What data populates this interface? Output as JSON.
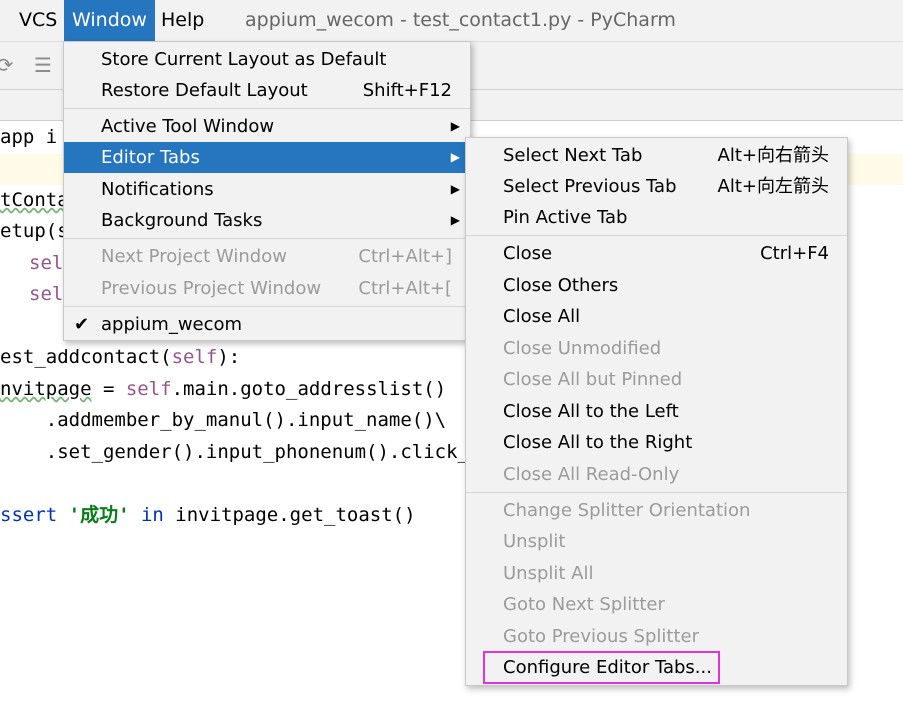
{
  "menubar": {
    "vcs": "VCS",
    "window": "Window",
    "help": "Help",
    "title": "appium_wecom - test_contact1.py - PyCharm"
  },
  "code": {
    "l1": "app i",
    "l2": "tConta",
    "l3": "etup(s",
    "l4": "sel",
    "l5": "sel",
    "l6a": "est_addcontact(",
    "l6b": "self",
    "l6c": "):",
    "l7a": "nvitpage",
    "l7b": " = ",
    "l7c": "self",
    "l7d": ".main.goto_addresslist()",
    "l8": "    .addmember_by_manul().input_name()\\",
    "l9": "    .set_gender().input_phonenum().click_",
    "l10a": "ssert ",
    "l10b": "'成功'",
    "l10c": " in ",
    "l10d": "invitpage.get_toast()"
  },
  "window_menu": {
    "store_layout": "Store Current Layout as Default",
    "restore_layout": "Restore Default Layout",
    "restore_shortcut": "Shift+F12",
    "active_tool": "Active Tool Window",
    "editor_tabs": "Editor Tabs",
    "notifications": "Notifications",
    "background_tasks": "Background Tasks",
    "next_project": "Next Project Window",
    "next_project_shortcut": "Ctrl+Alt+]",
    "prev_project": "Previous Project Window",
    "prev_project_shortcut": "Ctrl+Alt+[",
    "project_name": "appium_wecom"
  },
  "tabs_menu": {
    "select_next": "Select Next Tab",
    "select_next_shortcut": "Alt+向右箭头",
    "select_prev": "Select Previous Tab",
    "select_prev_shortcut": "Alt+向左箭头",
    "pin": "Pin Active Tab",
    "close": "Close",
    "close_shortcut": "Ctrl+F4",
    "close_others": "Close Others",
    "close_all": "Close All",
    "close_unmodified": "Close Unmodified",
    "close_all_but_pinned": "Close All but Pinned",
    "close_left": "Close All to the Left",
    "close_right": "Close All to the Right",
    "close_readonly": "Close All Read-Only",
    "change_splitter": "Change Splitter Orientation",
    "unsplit": "Unsplit",
    "unsplit_all": "Unsplit All",
    "goto_next_splitter": "Goto Next Splitter",
    "goto_prev_splitter": "Goto Previous Splitter",
    "configure": "Configure Editor Tabs..."
  },
  "colors": {
    "accent": "#2675bf",
    "highlight_box": "#e033e0",
    "disabled_text": "#9b9b9b"
  },
  "icons": [
    "run-icon",
    "structure-icon",
    "check-icon",
    "submenu-arrow-icon"
  ]
}
